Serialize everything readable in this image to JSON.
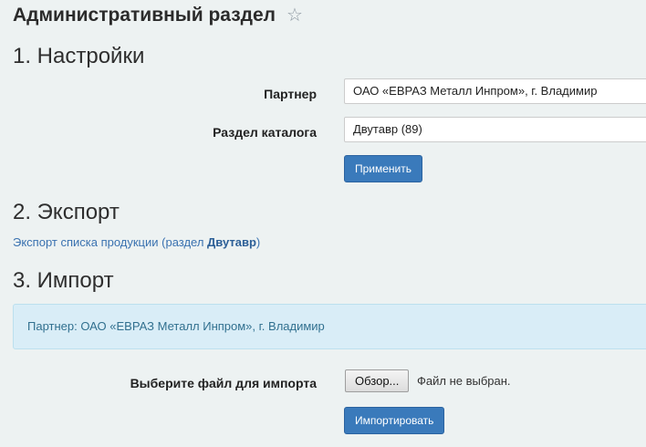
{
  "header": {
    "title": "Административный раздел",
    "favorite_icon": "star-icon"
  },
  "settings": {
    "heading": "1. Настройки",
    "partner_label": "Партнер",
    "partner_value": "ОАО «ЕВРАЗ Металл Инпром», г. Владимир",
    "catalog_label": "Раздел каталога",
    "catalog_value": "Двутавр (89)",
    "apply_button": "Применить"
  },
  "export": {
    "heading": "2. Экспорт",
    "link_prefix": "Экспорт списка продукции (раздел ",
    "link_section": "Двутавр",
    "link_suffix": ")"
  },
  "import": {
    "heading": "3. Импорт",
    "partner_info": "Партнер: ОАО «ЕВРАЗ Металл Инпром», г. Владимир",
    "file_label": "Выберите файл для импорта",
    "browse_button": "Обзор...",
    "file_status": "Файл не выбран.",
    "import_button": "Импортировать"
  },
  "colors": {
    "accent": "#3a7abb",
    "info_bg": "#d9edf7",
    "page_bg": "#edf2f2"
  }
}
